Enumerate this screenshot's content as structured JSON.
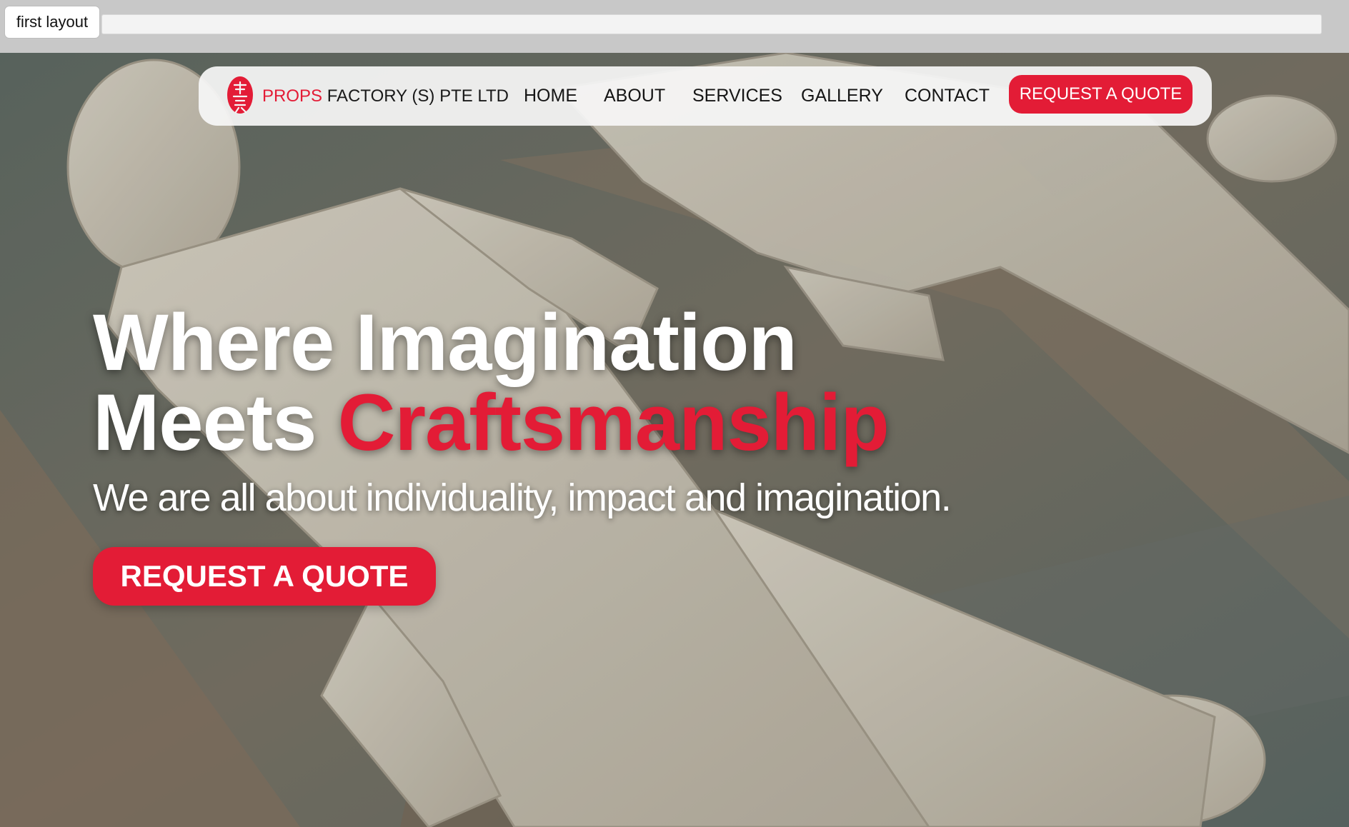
{
  "editor": {
    "layout_tab_label": "first layout"
  },
  "nav": {
    "brand_highlight": "PROPS",
    "brand_rest": " FACTORY (S) PTE LTD",
    "links": [
      "HOME",
      "ABOUT",
      "SERVICES",
      "GALLERY",
      "CONTACT"
    ],
    "cta_label": "REQUEST A QUOTE"
  },
  "hero": {
    "headline_line1": "Where Imagination",
    "headline_line2_white": "Meets ",
    "headline_line2_red": "Craftsmanship",
    "subheadline": "We are all about individuality, impact and imagination.",
    "cta_label": "REQUEST A QUOTE"
  },
  "colors": {
    "accent": "#e31c36",
    "nav_background": "#f6f6f6",
    "editor_strip": "#c8c8c8"
  },
  "icons": {
    "brand_logo": "red-chinese-seal-logo"
  }
}
